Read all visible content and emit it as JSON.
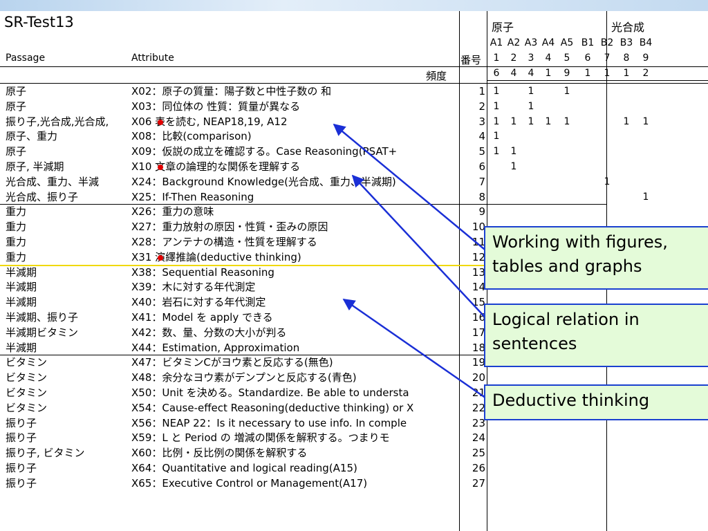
{
  "title": "SR-Test13",
  "headers": {
    "passage": "Passage",
    "attribute": "Attribute",
    "number": "番号",
    "frequency": "頻度",
    "group_atom": "原子",
    "group_photo": "光合成",
    "codes": [
      "A1",
      "A2",
      "A3",
      "A4",
      "A5",
      "B1",
      "B2",
      "B3",
      "B4"
    ],
    "indices": [
      "1",
      "2",
      "3",
      "4",
      "5",
      "6",
      "7",
      "8",
      "9"
    ],
    "freqs": [
      "6",
      "4",
      "4",
      "1",
      "9",
      "1",
      "1",
      "1",
      "2"
    ]
  },
  "rows": [
    {
      "passage": "原子",
      "attribute": "X02：原子の質量：陽子数と中性子数の 和",
      "num": "1",
      "marks": [
        1,
        0,
        1,
        0,
        1,
        0,
        0,
        0,
        0
      ]
    },
    {
      "passage": "原子",
      "attribute": "X03：同位体の 性質：質量が異なる",
      "num": "2",
      "marks": [
        1,
        0,
        1,
        0,
        0,
        0,
        0,
        0,
        0
      ]
    },
    {
      "passage": "振り子,光合成,光合成,",
      "attribute": "X06 表を読む, NEAP18,19, A12",
      "num": "3",
      "marks": [
        1,
        1,
        1,
        1,
        1,
        0,
        0,
        1,
        1
      ]
    },
    {
      "passage": "原子、重力",
      "attribute": "X08：比較(comparison)",
      "num": "4",
      "marks": [
        1,
        0,
        0,
        0,
        0,
        0,
        0,
        0,
        0
      ]
    },
    {
      "passage": "原子",
      "attribute": "X09：仮説の成立を確認する。Case Reasoning(PSAT+",
      "num": "5",
      "marks": [
        1,
        1,
        0,
        0,
        0,
        0,
        0,
        0,
        0
      ]
    },
    {
      "passage": "原子, 半減期",
      "attribute": "X10 文章の論理的な関係を理解する",
      "num": "6",
      "marks": [
        0,
        1,
        0,
        0,
        0,
        0,
        0,
        0,
        0
      ]
    },
    {
      "passage": "光合成、重力、半減",
      "attribute": "X24：Background Knowledge(光合成、重力、半減期)",
      "num": "7",
      "marks": [
        0,
        0,
        0,
        0,
        0,
        0,
        1,
        0,
        0
      ]
    },
    {
      "passage": "光合成、振り子",
      "attribute": "X25：If-Then Reasoning",
      "num": "8",
      "marks": [
        0,
        0,
        0,
        0,
        0,
        0,
        0,
        0,
        1
      ]
    },
    {
      "passage": "重力",
      "attribute": "X26：重力の意味",
      "num": "9",
      "marks": [
        0,
        0,
        0,
        0,
        0,
        0,
        0,
        0,
        0
      ]
    },
    {
      "passage": "重力",
      "attribute": "X27：重力放射の原因・性質・歪みの原因",
      "num": "10",
      "marks": [
        0,
        0,
        0,
        0,
        0,
        0,
        0,
        0,
        0
      ]
    },
    {
      "passage": "重力",
      "attribute": "X28：アンテナの構造・性質を理解する",
      "num": "11",
      "marks": [
        0,
        0,
        0,
        0,
        0,
        0,
        0,
        0,
        0
      ]
    },
    {
      "passage": "重力",
      "attribute": "X31 演繹推論(deductive thinking)",
      "num": "12",
      "marks": [
        0,
        0,
        0,
        0,
        0,
        0,
        0,
        0,
        0
      ]
    },
    {
      "passage": "半減期",
      "attribute": "X38：Sequential Reasoning",
      "num": "13",
      "marks": [
        0,
        0,
        0,
        0,
        0,
        0,
        0,
        0,
        0
      ]
    },
    {
      "passage": "半減期",
      "attribute": "X39：木に対する年代測定",
      "num": "14",
      "marks": [
        0,
        0,
        0,
        0,
        0,
        0,
        0,
        0,
        0
      ]
    },
    {
      "passage": "半減期",
      "attribute": "X40：岩石に対する年代測定",
      "num": "15",
      "marks": [
        0,
        0,
        0,
        0,
        0,
        0,
        0,
        0,
        0
      ]
    },
    {
      "passage": "半減期、振り子",
      "attribute": "X41：Model を apply できる",
      "num": "16",
      "marks": [
        0,
        0,
        0,
        0,
        0,
        0,
        0,
        0,
        0
      ]
    },
    {
      "passage": "半減期ビタミン",
      "attribute": "X42：数、量、分数の大小が判る",
      "num": "17",
      "marks": [
        0,
        0,
        0,
        0,
        0,
        0,
        0,
        0,
        0
      ]
    },
    {
      "passage": "半減期",
      "attribute": "X44：Estimation, Approximation",
      "num": "18",
      "marks": [
        0,
        0,
        0,
        0,
        0,
        0,
        0,
        0,
        0
      ]
    },
    {
      "passage": "ビタミン",
      "attribute": "X47：ビタミンCがヨウ素と反応する(無色)",
      "num": "19",
      "marks": [
        0,
        0,
        0,
        0,
        0,
        0,
        0,
        0,
        0
      ]
    },
    {
      "passage": "ビタミン",
      "attribute": "X48：余分なヨウ素がデンプンと反応する(青色)",
      "num": "20",
      "marks": [
        0,
        0,
        0,
        0,
        0,
        0,
        0,
        0,
        0
      ]
    },
    {
      "passage": "ビタミン",
      "attribute": "X50：Unit を決める。Standardize. Be able to understa",
      "num": "21",
      "marks": [
        0,
        0,
        0,
        0,
        0,
        0,
        0,
        0,
        0
      ]
    },
    {
      "passage": "ビタミン",
      "attribute": "X54：Cause-effect Reasoning(deductive thinking) or X",
      "num": "22",
      "marks": [
        0,
        0,
        0,
        0,
        0,
        0,
        0,
        0,
        0
      ]
    },
    {
      "passage": "振り子",
      "attribute": "X56：NEAP 22：Is it necessary to use info. In comple",
      "num": "23",
      "marks": [
        0,
        0,
        0,
        0,
        0,
        0,
        0,
        0,
        0
      ]
    },
    {
      "passage": "振り子",
      "attribute": "X59：L と Period の 増減の関係を解釈する。つまりモ",
      "num": "24",
      "marks": [
        0,
        0,
        0,
        0,
        0,
        0,
        0,
        0,
        0
      ]
    },
    {
      "passage": "振り子, ビタミン",
      "attribute": "X60：比例・反比例の関係を解釈する",
      "num": "25",
      "marks": [
        0,
        0,
        0,
        0,
        0,
        0,
        0,
        0,
        0
      ]
    },
    {
      "passage": "振り子",
      "attribute": "X64：Quantitative and logical reading(A15)",
      "num": "26",
      "marks": [
        0,
        0,
        0,
        0,
        0,
        0,
        0,
        0,
        0
      ]
    },
    {
      "passage": "振り子",
      "attribute": "X65：Executive Control or Management(A17)",
      "num": "27",
      "marks": [
        0,
        0,
        0,
        0,
        0,
        0,
        0,
        0,
        0
      ]
    }
  ],
  "mark_symbol": "1",
  "callouts": [
    {
      "text": "Working with figures, tables and graphs"
    },
    {
      "text": "Logical relation in sentences"
    },
    {
      "text": "Deductive thinking"
    }
  ],
  "colors": {
    "callout_bg": "#e4fbd9",
    "callout_border": "#1a40d0",
    "arrow": "#1a2fd6",
    "dot": "#e10000",
    "divider": "#f0d800"
  }
}
